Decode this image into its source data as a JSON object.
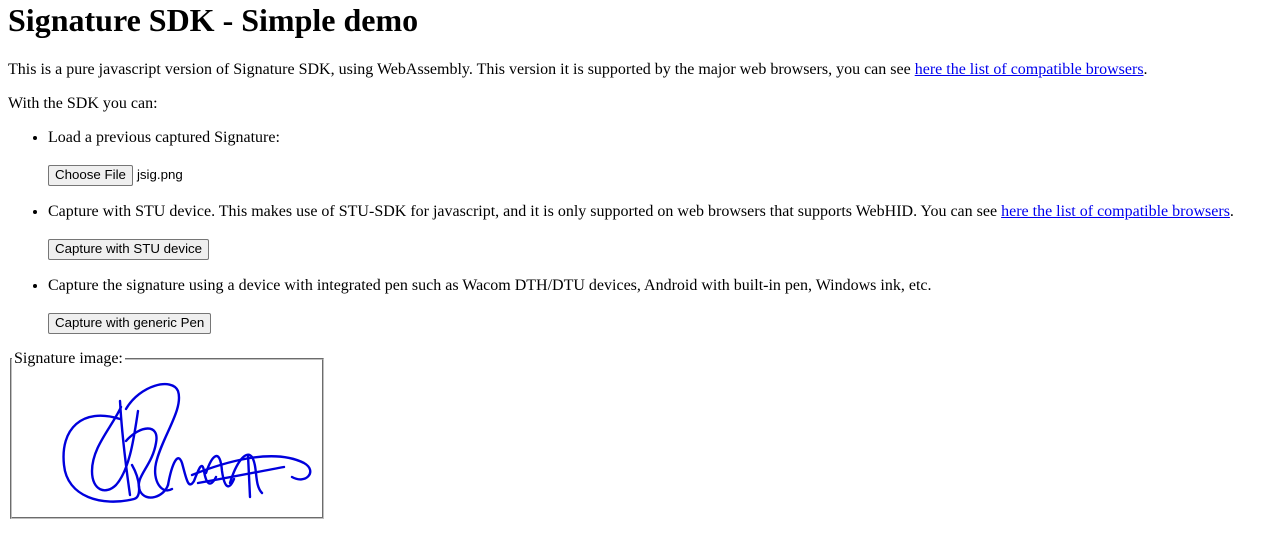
{
  "title": "Signature SDK - Simple demo",
  "intro": {
    "text": "This is a pure javascript version of Signature SDK, using WebAssembly. This version it is supported by the major web browsers, you can see ",
    "link": "here the list of compatible browsers",
    "suffix": "."
  },
  "with_sdk": "With the SDK you can:",
  "features": [
    {
      "text": "Load a previous captured Signature:",
      "button": "Choose File",
      "file_name": "jsig.png"
    },
    {
      "text": "Capture with STU device. This makes use of STU-SDK for javascript, and it is only supported on web browsers that supports WebHID. You can see ",
      "link": "here the list of compatible browsers",
      "suffix": ".",
      "button": "Capture with STU device"
    },
    {
      "text": "Capture the signature using a device with integrated pen such as Wacom DTH/DTU devices, Android with built-in pen, Windows ink, etc.",
      "button": "Capture with generic Pen"
    }
  ],
  "signature": {
    "legend": "Signature image:",
    "ink_color": "#0000dd"
  },
  "colors": {
    "link": "#0000ee",
    "button_bg": "#efefef"
  }
}
